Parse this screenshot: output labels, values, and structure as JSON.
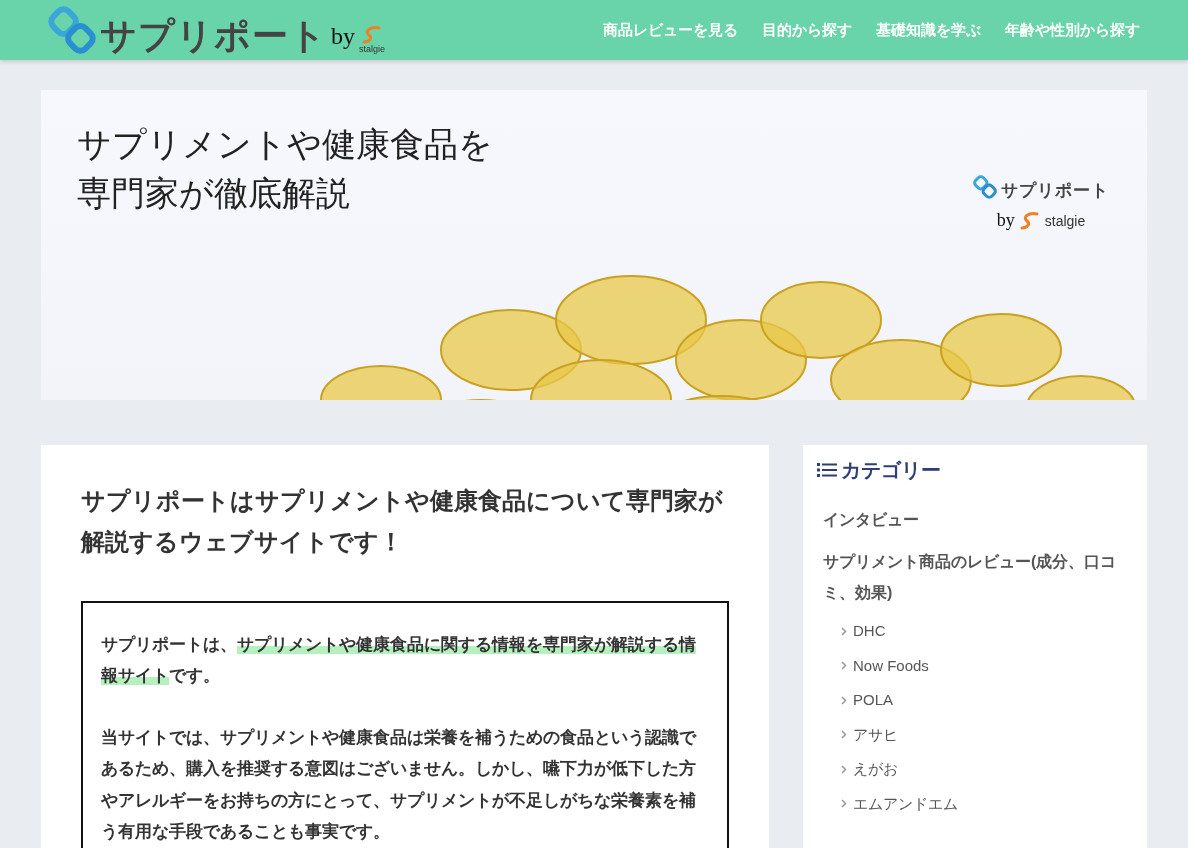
{
  "header": {
    "logo": {
      "name": "サプリポート",
      "by": "by",
      "brand": "stalgie"
    },
    "nav": [
      {
        "label": "商品レビューを見る"
      },
      {
        "label": "目的から探す"
      },
      {
        "label": "基礎知識を学ぶ"
      },
      {
        "label": "年齢や性別から探す"
      }
    ]
  },
  "banner": {
    "headline": [
      "サプリメントや健康食品を",
      "専門家が徹底解説"
    ],
    "logo": {
      "name": "サプリポート",
      "by": "by",
      "brand": "stalgie"
    }
  },
  "article": {
    "title": "サプリポートはサプリメントや健康食品について専門家が解説するウェブサイトです！",
    "box": [
      [
        {
          "text": "サプリポートは、",
          "highlighted": false
        },
        {
          "text": "サプリメントや健康食品に関する情報を専門家が解説する情報サイト",
          "highlighted": true
        },
        {
          "text": "です。",
          "highlighted": false
        }
      ],
      [
        {
          "text": "当サイトでは、サプリメントや健康食品は栄養を補うための食品という認識であるため、購入を推奨する意図はございません。しかし、嚥下力が低下した方やアレルギーをお持ちの方にとって、サプリメントが不足しがちな栄養素を補う有用な手段であることも事実です。",
          "highlighted": false
        }
      ]
    ]
  },
  "sidebar": {
    "title": "カテゴリー",
    "items": [
      {
        "label": "インタビュー"
      },
      {
        "label": "サプリメント商品のレビュー(成分、口コミ、効果)",
        "children": [
          {
            "label": "DHC"
          },
          {
            "label": "Now Foods"
          },
          {
            "label": "POLA"
          },
          {
            "label": "アサヒ"
          },
          {
            "label": "えがお"
          },
          {
            "label": "エムアンドエム"
          }
        ]
      }
    ]
  }
}
